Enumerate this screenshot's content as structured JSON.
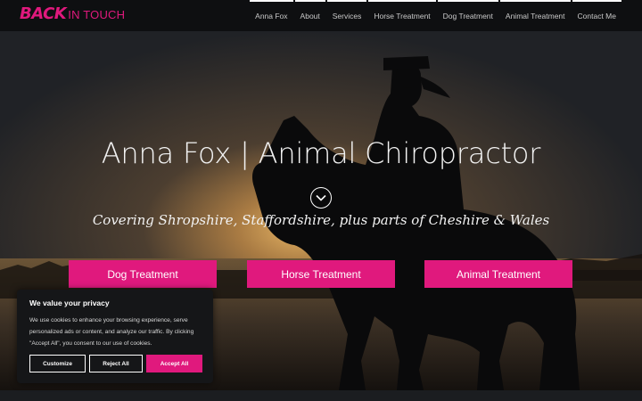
{
  "logo": {
    "back": "BACK",
    "touch": "IN TOUCH"
  },
  "nav": {
    "items": [
      {
        "label": "Anna Fox"
      },
      {
        "label": "About"
      },
      {
        "label": "Services"
      },
      {
        "label": "Horse Treatment"
      },
      {
        "label": "Dog Treatment"
      },
      {
        "label": "Animal Treatment"
      },
      {
        "label": "Contact Me"
      }
    ]
  },
  "hero": {
    "title": "Anna Fox | Animal Chiropractor",
    "subtitle": "Covering Shropshire, Staffordshire, plus parts of Cheshire & Wales",
    "down_icon": "chevron-down-circle-icon"
  },
  "cta": {
    "dog": "Dog Treatment",
    "horse": "Horse Treatment",
    "animal": "Animal Treatment"
  },
  "cookie": {
    "title": "We value your privacy",
    "text": "We use cookies to enhance your browsing experience, serve personalized ads or content, and analyze our traffic. By clicking \"Accept All\", you consent to our use of cookies.",
    "customize": "Customize",
    "reject": "Reject All",
    "accept": "Accept All"
  },
  "colors": {
    "accent": "#e0197d",
    "header_bg": "#0e0f11",
    "sky_glow": "#d8a457"
  }
}
